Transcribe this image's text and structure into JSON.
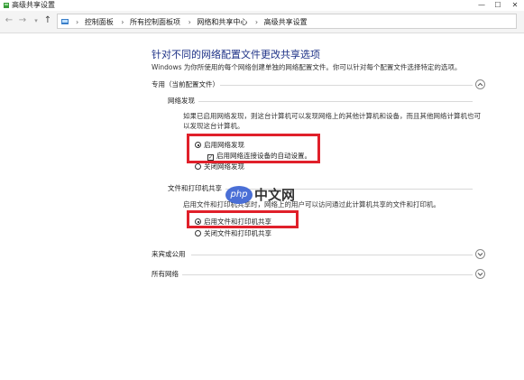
{
  "window": {
    "title": "高级共享设置"
  },
  "breadcrumb": [
    "控制面板",
    "所有控制面板项",
    "网络和共享中心",
    "高级共享设置"
  ],
  "heading": "针对不同的网络配置文件更改共享选项",
  "subtext": "Windows 为你所使用的每个网络创建单独的网络配置文件。你可以针对每个配置文件选择特定的选项。",
  "profiles": {
    "private": {
      "label": "专用（当前配置文件）",
      "discovery": {
        "title": "网络发现",
        "desc": "如果已启用网络发现，则这台计算机可以发现网络上的其他计算机和设备，而且其他网络计算机也可以发现这台计算机。",
        "on": "启用网络发现",
        "auto": "启用网络连接设备的自动设置。",
        "off": "关闭网络发现"
      },
      "sharing": {
        "title": "文件和打印机共享",
        "desc": "启用文件和打印机共享时，网络上的用户可以访问通过此计算机共享的文件和打印机。",
        "on": "启用文件和打印机共享",
        "off": "关闭文件和打印机共享"
      }
    },
    "guest": {
      "label": "来宾或公用"
    },
    "all": {
      "label": "所有网络"
    }
  },
  "watermark": {
    "logo": "php",
    "text": "中文网"
  },
  "colors": {
    "heading": "#1e3287",
    "highlight": "#e0202a"
  }
}
